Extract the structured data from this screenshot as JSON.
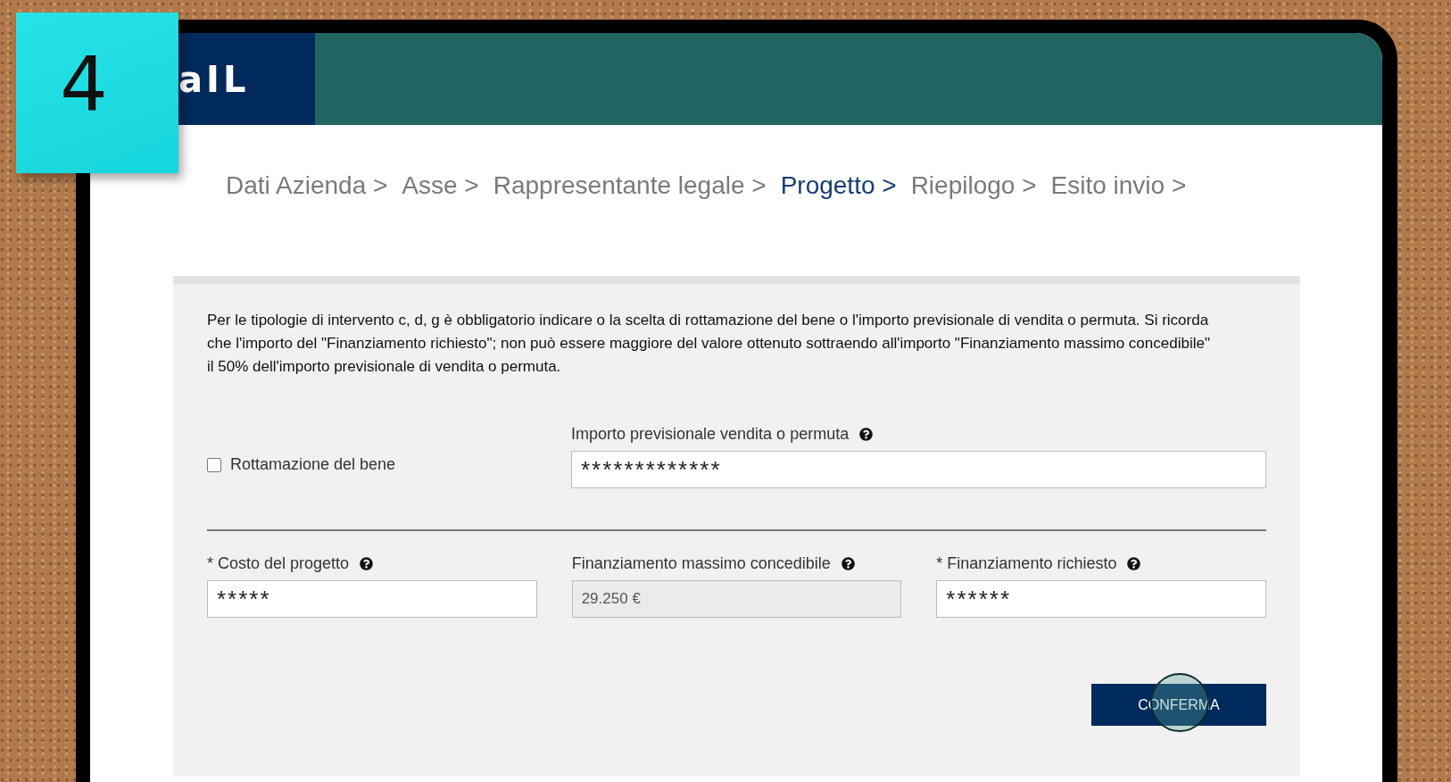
{
  "sticky_note": {
    "text": "4"
  },
  "header": {
    "logo": "aIL"
  },
  "breadcrumb": [
    {
      "label": "Dati Azienda >",
      "selected": false
    },
    {
      "label": "Asse >",
      "selected": false
    },
    {
      "label": "Rappresentante legale >",
      "selected": false
    },
    {
      "label": "Progetto >",
      "selected": true
    },
    {
      "label": "Riepilogo >",
      "selected": false
    },
    {
      "label": "Esito invio >",
      "selected": false
    }
  ],
  "notice": "Per le tipologie di intervento c, d, g è obbligatorio indicare o la scelta di rottamazione del bene o l'importo previsionale di vendita o permuta. Si ricorda che l'importo del \"Finanziamento richiesto\"; non può essere maggiore del valore ottenuto sottraendo all'importo \"Finanziamento massimo concedibile\" il 50% dell'importo previsionale di vendita o permuta.",
  "rottamazione": {
    "label": "Rottamazione del bene",
    "checked": false
  },
  "importo_field": {
    "label": "Importo previsionale vendita o permuta",
    "value": "*************",
    "disabled": false
  },
  "fields": [
    {
      "label": "* Costo del progetto",
      "value": "*****",
      "disabled": false
    },
    {
      "label": "Finanziamento massimo concedibile",
      "value": "29.250 €",
      "disabled": true
    },
    {
      "label": "* Finanziamento richiesto",
      "value": "******",
      "disabled": false
    }
  ],
  "button": {
    "label": "CONFERMA"
  }
}
